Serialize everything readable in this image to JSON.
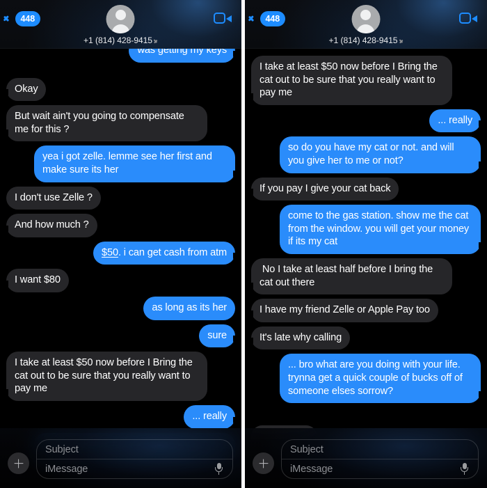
{
  "app": "iMessage",
  "colors": {
    "accent_blue": "#2a8cfb",
    "bubble_them": "#262629",
    "background": "#000000",
    "badge_blue": "#1d8cff",
    "placeholder": "#8b8d91"
  },
  "header": {
    "back_badge": "448",
    "back_icon": "chevron-left-icon",
    "phone_number": "+1 (814) 428-9415",
    "detail_chevron": "chevron-right-icon",
    "facetime_icon": "video-camera-icon",
    "avatar_icon": "person-placeholder-avatar"
  },
  "composer": {
    "add_icon": "plus-icon",
    "subject_placeholder": "Subject",
    "subject_value": "",
    "message_placeholder": "iMessage",
    "message_value": "",
    "mic_icon": "microphone-icon"
  },
  "left_panel": {
    "messages": [
      {
        "from": "me",
        "text": "was getting my keys",
        "clipped_top": true,
        "tail": true
      },
      {
        "from": "them",
        "text": "Okay",
        "tail": true
      },
      {
        "from": "them",
        "text": "But wait ain't you going to compensate me for this ?",
        "tail": true
      },
      {
        "from": "me",
        "text": "yea i got zelle. lemme see her first and make sure its her",
        "tail": true
      },
      {
        "from": "them",
        "text": "I don't use Zelle ?",
        "tail": false
      },
      {
        "from": "them",
        "text": "And how much ?",
        "tail": true
      },
      {
        "from": "me",
        "text": "$50. i can get cash from atm",
        "link_prefix": "$50",
        "tail": true
      },
      {
        "from": "them",
        "text": "I want $80",
        "tail": true
      },
      {
        "from": "me",
        "text": "as long as its her",
        "tail": false
      },
      {
        "from": "me",
        "text": "sure",
        "tail": true
      },
      {
        "from": "them",
        "text": "I take at least $50 now before I Bring the cat out to be sure that you really want to pay me",
        "tail": true
      },
      {
        "from": "me",
        "text": "... really",
        "tail": true
      },
      {
        "from": "me",
        "text": "so do you have my cat or not. and will you give her to me or not?",
        "clipped_bottom": true,
        "tail": true
      }
    ]
  },
  "right_panel": {
    "messages": [
      {
        "from": "them",
        "text": "I take at least $50 now before I Bring the cat out to be sure that you really want to pay me",
        "tail": true
      },
      {
        "from": "me",
        "text": "... really",
        "tail": true
      },
      {
        "from": "me",
        "text": "so do you have my cat or not. and will you give her to me or not?",
        "tail": true
      },
      {
        "from": "them",
        "text": "If you pay I give your cat back",
        "tail": true
      },
      {
        "from": "me",
        "text": "come to the gas station. show me the cat from the window. you will get your money if its my cat",
        "tail": true
      },
      {
        "from": "them",
        "text": " No I take at least half before I bring the cat out there",
        "tail": true
      },
      {
        "from": "them",
        "text": "I have my friend Zelle or Apple Pay too",
        "tail": true
      },
      {
        "from": "them",
        "text": "It's late why calling",
        "tail": true
      },
      {
        "from": "me",
        "text": "... bro what are you doing with your life. trynna get a quick couple of bucks off of someone elses sorrow?",
        "tail": true
      }
    ],
    "hidden_bubble_behind_composer": true
  }
}
